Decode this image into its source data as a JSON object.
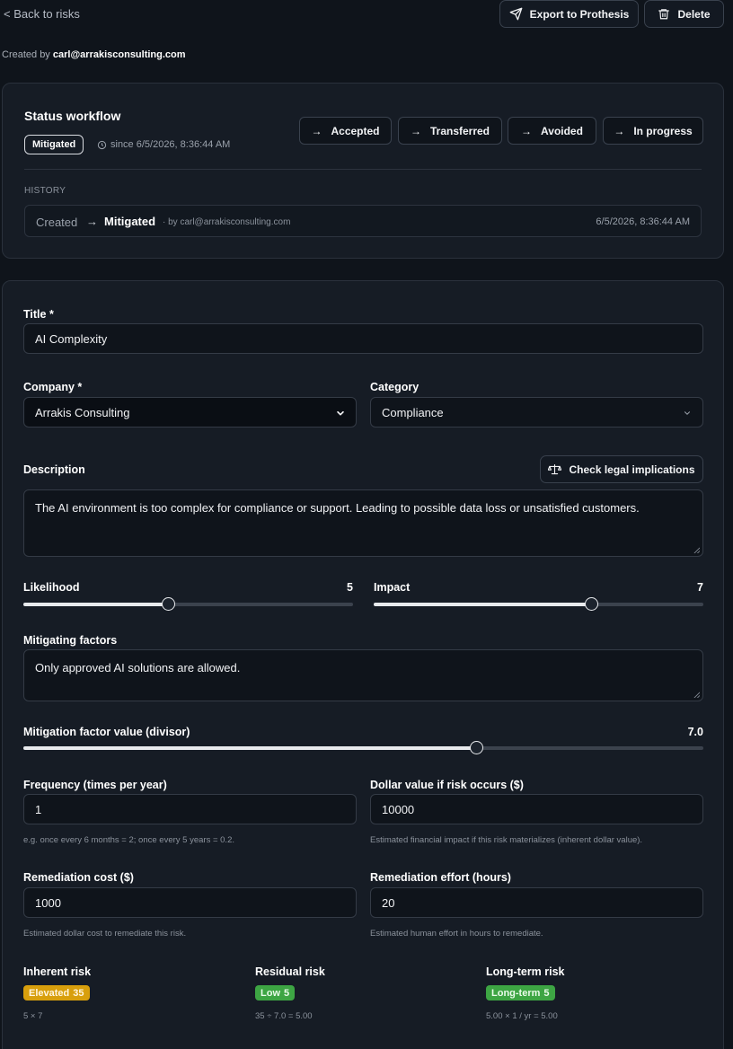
{
  "topbar": {
    "back_label": "< Back to risks",
    "export_label": "Export to Prothesis",
    "delete_label": "Delete"
  },
  "created": {
    "prefix": "Created by ",
    "email": "carl@arrakisconsulting.com"
  },
  "status": {
    "title": "Status workflow",
    "current": "Mitigated",
    "since": "since 6/5/2026, 8:36:44 AM",
    "actions": [
      "Accepted",
      "Transferred",
      "Avoided",
      "In progress"
    ],
    "history_label": "HISTORY",
    "history": {
      "from": "Created",
      "to": "Mitigated",
      "by": "· by carl@arrakisconsulting.com",
      "date": "6/5/2026, 8:36:44 AM"
    }
  },
  "form": {
    "title": {
      "label": "Title *",
      "value": "AI Complexity"
    },
    "company": {
      "label": "Company *",
      "value": "Arrakis Consulting"
    },
    "category": {
      "label": "Category",
      "value": "Compliance"
    },
    "description": {
      "label": "Description",
      "legal_button": "Check legal implications",
      "value": "The AI environment is too complex for compliance or support.  Leading to possible data loss or unsatisfied customers."
    },
    "likelihood": {
      "label": "Likelihood",
      "value": "5",
      "fraction": 0.44
    },
    "impact": {
      "label": "Impact",
      "value": "7",
      "fraction": 0.66
    },
    "mitigating": {
      "label": "Mitigating factors",
      "value": "Only approved AI solutions are allowed."
    },
    "mitigation_value": {
      "label": "Mitigation factor value (divisor)",
      "value": "7.0",
      "fraction": 0.666
    },
    "frequency": {
      "label": "Frequency (times per year)",
      "value": "1",
      "help": "e.g. once every 6 months = 2; once every 5 years = 0.2."
    },
    "dollar": {
      "label": "Dollar value if risk occurs ($)",
      "value": "10000",
      "help": "Estimated financial impact if this risk materializes (inherent dollar value)."
    },
    "rem_cost": {
      "label": "Remediation cost ($)",
      "value": "1000",
      "help": "Estimated dollar cost to remediate this risk."
    },
    "rem_effort": {
      "label": "Remediation effort (hours)",
      "value": "20",
      "help": "Estimated human effort in hours to remediate."
    }
  },
  "risks": {
    "inherent": {
      "label": "Inherent risk",
      "badge_text": "Elevated",
      "badge_value": "35",
      "formula": "5 × 7",
      "color": "#d89f0c"
    },
    "residual": {
      "label": "Residual risk",
      "badge_text": "Low",
      "badge_value": "5",
      "formula": "35 ÷ 7.0 = 5.00",
      "color": "#3da543"
    },
    "longterm": {
      "label": "Long-term risk",
      "badge_text": "Long-term",
      "badge_value": "5",
      "formula": "5.00 × 1 / yr = 5.00",
      "color": "#3da543"
    }
  }
}
